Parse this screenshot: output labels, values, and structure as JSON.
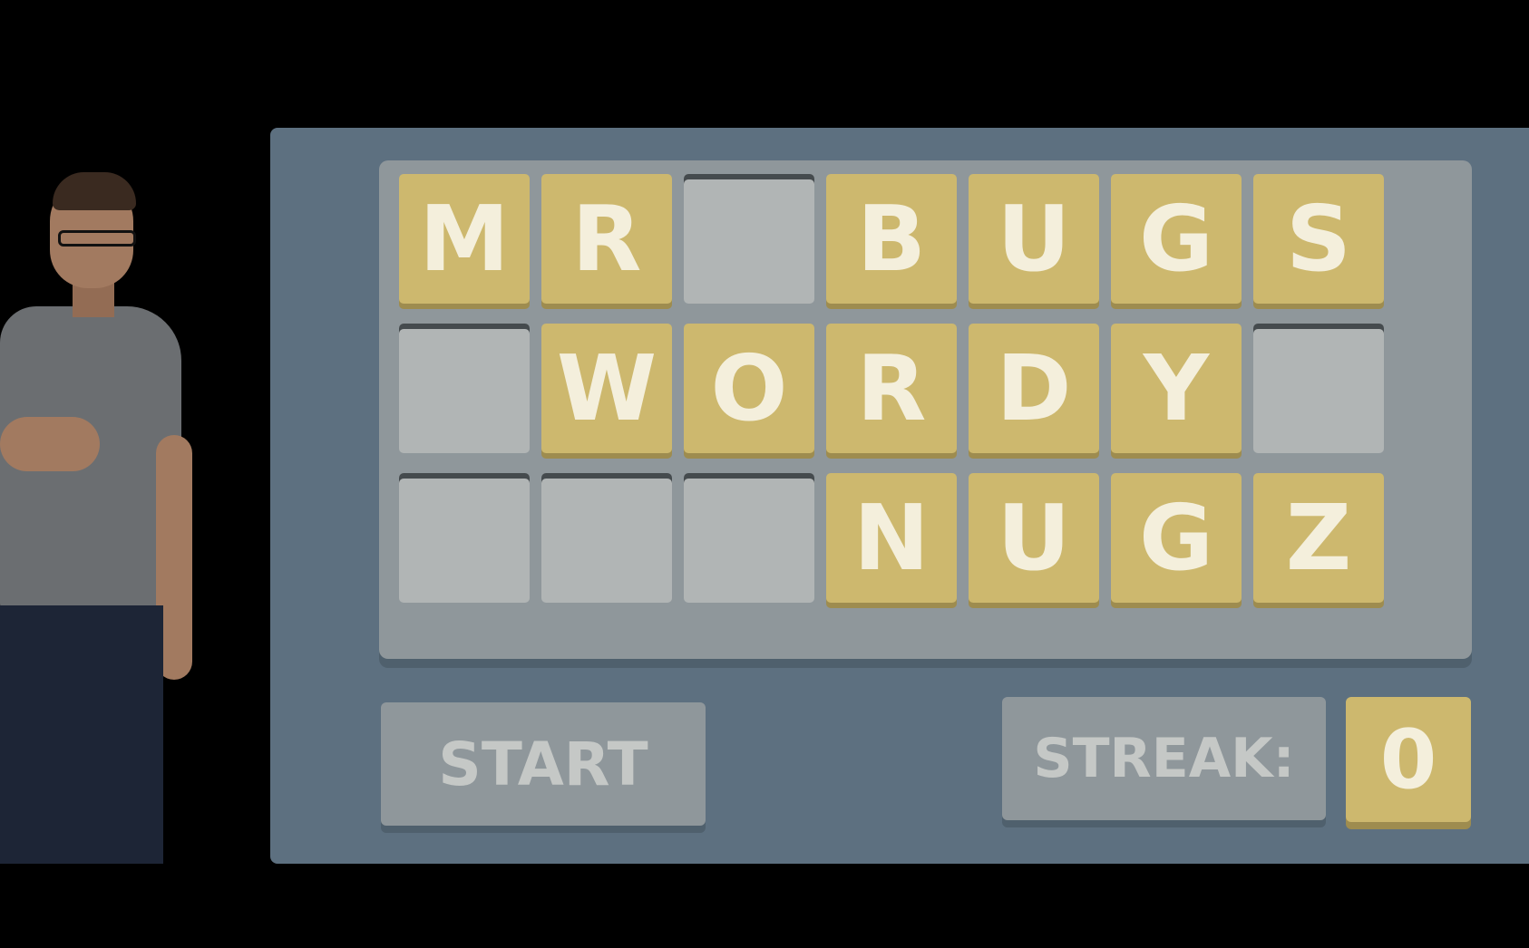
{
  "board": {
    "rows": [
      [
        "M",
        "R",
        "",
        "B",
        "U",
        "G",
        "S"
      ],
      [
        "",
        "W",
        "O",
        "R",
        "D",
        "Y",
        ""
      ],
      [
        "",
        "",
        "",
        "N",
        "U",
        "G",
        "Z"
      ]
    ]
  },
  "controls": {
    "start_label": "START",
    "streak_label": "STREAK:",
    "streak_value": "0"
  },
  "colors": {
    "tile_filled": "#cdb86e",
    "tile_empty": "#b1b5b5",
    "panel": "#5d7080",
    "board": "#8f979b"
  }
}
